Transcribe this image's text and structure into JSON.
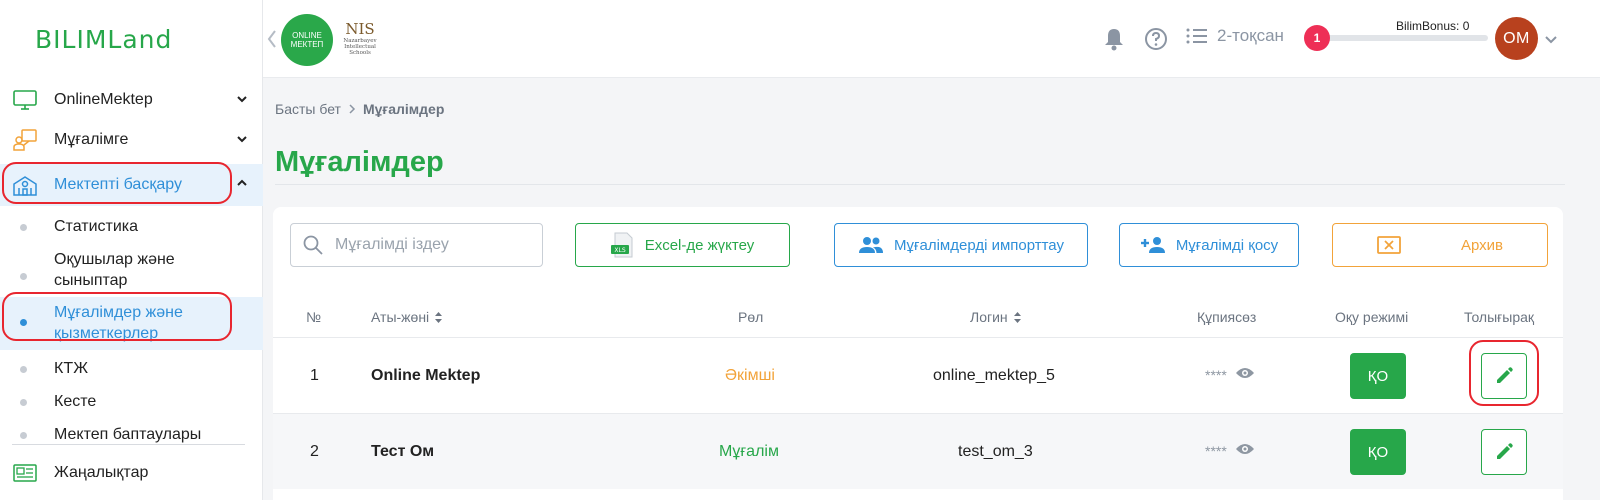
{
  "brand": {
    "logo_text": "BILIMLand",
    "online_logo_line1": "ONLINE",
    "online_logo_line2": "МЕКТЕП",
    "nis_title": "NIS",
    "nis_sub1": "Nazarbayev",
    "nis_sub2": "Intellectual",
    "nis_sub3": "Schools"
  },
  "sidebar": {
    "items": [
      {
        "label": "OnlineMektep",
        "icon": "monitor-icon"
      },
      {
        "label": "Мұғалімге",
        "icon": "teacher-board-icon"
      },
      {
        "label": "Мектепті басқару",
        "icon": "school-building-icon"
      }
    ],
    "sub_items": [
      {
        "label": "Статистика"
      },
      {
        "label": "Оқушылар және сыныптар"
      },
      {
        "label": "Мұғалімдер және қызметкерлер"
      },
      {
        "label": "КТЖ"
      },
      {
        "label": "Кесте"
      },
      {
        "label": "Мектеп баптаулары"
      }
    ],
    "news": {
      "label": "Жаңалықтар",
      "icon": "newspaper-icon"
    }
  },
  "topbar": {
    "quarter_label": "2-тоқсан",
    "bonus_label": "BilimBonus: 0",
    "bonus_level": "1",
    "avatar_initials": "OM"
  },
  "breadcrumb": {
    "home": "Басты бет",
    "current": "Мұғалімдер"
  },
  "page": {
    "title": "Мұғалімдер"
  },
  "toolbar": {
    "search_placeholder": "Мұғалімді іздеу",
    "excel_label": "Excel-де жүктеу",
    "excel_icon_text": "XLS",
    "import_label": "Мұғалімдерді импорттау",
    "add_label": "Мұғалімді қосу",
    "archive_label": "Архив"
  },
  "table": {
    "headers": {
      "num": "№",
      "name": "Аты-жөні",
      "role": "Рөл",
      "login": "Логин",
      "password": "Құпиясөз",
      "mode": "Оқу режимі",
      "more": "Толығырақ"
    },
    "rows": [
      {
        "num": "1",
        "name": "Online Mektep",
        "role": "Әкімші",
        "login": "online_mektep_5",
        "password": "****",
        "mode": "ҚО"
      },
      {
        "num": "2",
        "name": "Тест Ом",
        "role": "Мұғалім",
        "login": "test_om_3",
        "password": "****",
        "mode": "ҚО"
      }
    ]
  },
  "colors": {
    "green": "#27a74a",
    "blue": "#2f8fd8",
    "orange": "#f2a33a",
    "highlight": "#e8262f",
    "badge": "#ee2f56"
  }
}
